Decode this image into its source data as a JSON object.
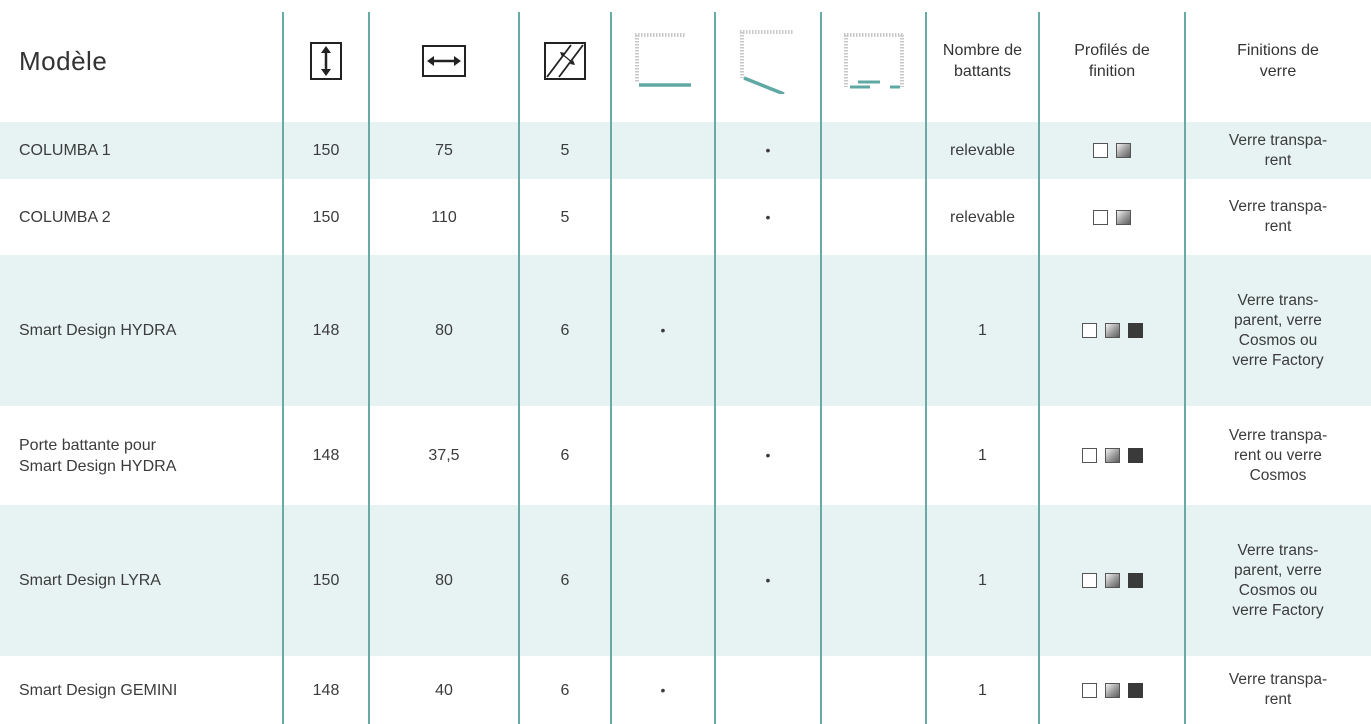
{
  "header": {
    "model": "Modèle",
    "height_icon": "height-icon",
    "width_icon": "width-icon",
    "thickness_icon": "glass-thickness-icon",
    "door1_icon": "fixed-panel-plan-icon",
    "door2_icon": "swing-door-plan-icon",
    "door3_icon": "sliding-door-plan-icon",
    "leaves": "Nombre de\nbattants",
    "profiles": "Profilés de\nfinition",
    "glass": "Finitions de\nverre"
  },
  "colors": {
    "accent": "#5fa8a3",
    "row_tint": "#e6f3f2",
    "divider": "#69aaa6"
  },
  "rows": [
    {
      "model": "COLUMBA 1",
      "height": "150",
      "width": "75",
      "thickness": "5",
      "d1": "",
      "d2": "•",
      "d3": "",
      "leaves": "relevable",
      "profiles": [
        "white",
        "chrome"
      ],
      "glass": "Verre transpa-\nrent"
    },
    {
      "model": "COLUMBA 2",
      "height": "150",
      "width": "110",
      "thickness": "5",
      "d1": "",
      "d2": "•",
      "d3": "",
      "leaves": "relevable",
      "profiles": [
        "white",
        "chrome"
      ],
      "glass": "Verre transpa-\nrent"
    },
    {
      "model": "Smart Design HYDRA",
      "height": "148",
      "width": "80",
      "thickness": "6",
      "d1": "•",
      "d2": "",
      "d3": "",
      "leaves": "1",
      "profiles": [
        "white",
        "chrome",
        "black"
      ],
      "glass": "Verre trans-\nparent, verre\nCosmos ou\nverre Factory"
    },
    {
      "model": "Porte battante pour\nSmart Design HYDRA",
      "height": "148",
      "width": "37,5",
      "thickness": "6",
      "d1": "",
      "d2": "•",
      "d3": "",
      "leaves": "1",
      "profiles": [
        "white",
        "chrome",
        "black"
      ],
      "glass": "Verre transpa-\nrent ou verre\nCosmos"
    },
    {
      "model": "Smart Design LYRA",
      "height": "150",
      "width": "80",
      "thickness": "6",
      "d1": "",
      "d2": "•",
      "d3": "",
      "leaves": "1",
      "profiles": [
        "white",
        "chrome",
        "black"
      ],
      "glass": "Verre trans-\nparent, verre\nCosmos ou\nverre Factory"
    },
    {
      "model": "Smart Design GEMINI",
      "height": "148",
      "width": "40",
      "thickness": "6",
      "d1": "•",
      "d2": "",
      "d3": "",
      "leaves": "1",
      "profiles": [
        "white",
        "chrome",
        "black"
      ],
      "glass": "Verre transpa-\nrent"
    }
  ]
}
